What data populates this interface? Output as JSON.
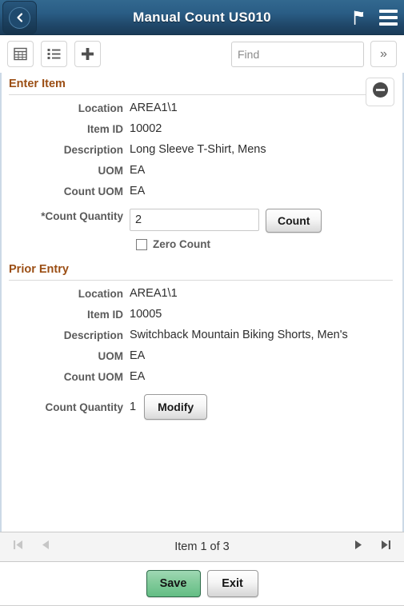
{
  "header": {
    "title": "Manual Count US010",
    "back_icon": "chevron-left-icon",
    "flag_icon": "flag-icon",
    "menu_icon": "hamburger-menu-icon"
  },
  "toolbar": {
    "grid_icon": "grid-view-icon",
    "list_icon": "list-view-icon",
    "add_icon": "plus-add-icon",
    "find_value": "",
    "find_placeholder": "Find",
    "expand_label": "»"
  },
  "enter_item": {
    "section_title": "Enter Item",
    "collapse_icon": "minus-circle-collapse-icon",
    "fields": [
      {
        "label": "Location",
        "value": "AREA1\\1"
      },
      {
        "label": "Item ID",
        "value": "10002"
      },
      {
        "label": "Description",
        "value": "Long Sleeve T-Shirt, Mens"
      },
      {
        "label": "UOM",
        "value": "EA"
      },
      {
        "label": "Count UOM",
        "value": "EA"
      }
    ],
    "count_quantity_label": "*Count Quantity",
    "count_quantity_value": "2",
    "count_button_label": "Count",
    "zero_count_label": "Zero Count",
    "zero_count_checked": false
  },
  "prior_entry": {
    "section_title": "Prior Entry",
    "fields": [
      {
        "label": "Location",
        "value": "AREA1\\1"
      },
      {
        "label": "Item ID",
        "value": "10005"
      },
      {
        "label": "Description",
        "value": "Switchback Mountain Biking Shorts, Men's"
      },
      {
        "label": "UOM",
        "value": "EA"
      },
      {
        "label": "Count UOM",
        "value": "EA"
      }
    ],
    "count_quantity_label": "Count Quantity",
    "count_quantity_value": "1",
    "modify_button_label": "Modify"
  },
  "navigation": {
    "first_icon": "go-to-first-icon",
    "previous_icon": "go-to-previous-icon",
    "status": "Item 1 of 3",
    "next_icon": "go-to-next-icon",
    "last_icon": "go-to-last-icon",
    "first_enabled": false,
    "previous_enabled": false,
    "next_enabled": true,
    "last_enabled": true
  },
  "footer": {
    "save_label": "Save",
    "exit_label": "Exit"
  },
  "colors": {
    "header_top": "#32688f",
    "header_bottom": "#1a3b58",
    "section_title": "#9b4e14",
    "label_text": "#5b5b5b",
    "value_text": "#2e2e2e",
    "save_green": "#63bd84",
    "panel_border": "#ccd9e6",
    "arrow_disabled": "#c6c6c6",
    "arrow_enabled": "#555555"
  }
}
